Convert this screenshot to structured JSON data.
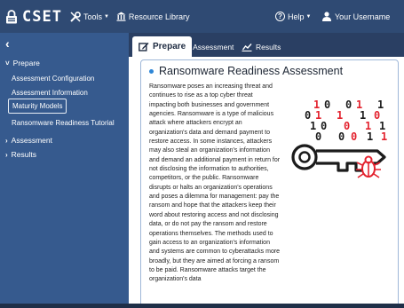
{
  "header": {
    "logo_text": "CSET",
    "tools_label": "Tools",
    "resource_library_label": "Resource Library",
    "help_label": "Help",
    "username_label": "Your Username"
  },
  "sidebar": {
    "collapse_icon": "chevron-left-icon",
    "sections": [
      {
        "label": "Prepare",
        "expanded": true,
        "items": [
          {
            "label": "Assessment Configuration",
            "active": false
          },
          {
            "label": "Assessment Information",
            "active": false
          },
          {
            "label": "Maturity Models",
            "active": true
          },
          {
            "label": "Ransomware Readiness Tutorial",
            "active": false
          }
        ]
      },
      {
        "label": "Assessment",
        "expanded": false
      },
      {
        "label": "Results",
        "expanded": false
      }
    ]
  },
  "tabs": [
    {
      "label": "Prepare",
      "icon": "edit-icon",
      "active": true
    },
    {
      "label": "Assessment",
      "icon": "question-icon",
      "active": false
    },
    {
      "label": "Results",
      "icon": "chart-icon",
      "active": false
    }
  ],
  "panel": {
    "title": "Ransomware Readiness Assessment",
    "body": "Ransomware poses an increasing threat and continues to rise as a top cyber threat impacting both businesses and government agencies. Ransomware is a type of malicious attack where attackers encrypt an organization's data and demand payment to restore access. In some instances, attackers may also steal an organization's information and demand an additional payment in return for not disclosing the information to authorities, competitors, or the public. Ransomware disrupts or halts an organization's operations and poses a dilemma for management: pay the ransom and hope that the attackers keep their word about restoring access and not disclosing data, or do not pay the ransom and restore operations themselves. The methods used to gain access to an organization's information and systems are common to cyberattacks more broadly, but they are aimed at forcing a ransom to be paid. Ransomware attacks target the organization's data"
  },
  "illustration": {
    "binary_rows": [
      "1 0 0 1 1",
      "0 1 1 1 0",
      "1 0 0 1 1",
      "0 0 0 1 1"
    ],
    "colors": {
      "red": "#e3222e",
      "dark": "#1b1b1b"
    }
  },
  "colors": {
    "topbar": "#2f4a73",
    "sidebar": "#365a8e",
    "tabsbar": "#2a3f63",
    "accent": "#2e86d6"
  }
}
